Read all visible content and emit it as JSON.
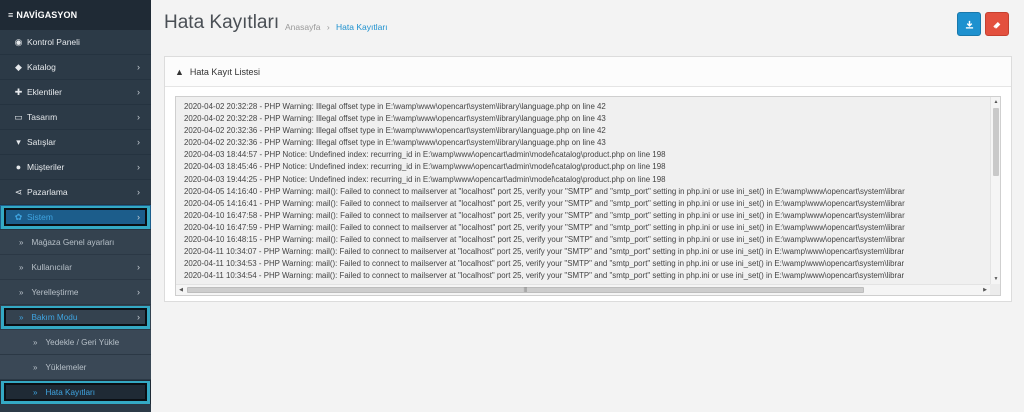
{
  "sidebar": {
    "heading": "NAVİGASYON",
    "items": [
      {
        "label": "Kontrol Paneli",
        "icon": "dashboard-icon",
        "glyph": "◉",
        "has_children": false
      },
      {
        "label": "Katalog",
        "icon": "tag-icon",
        "glyph": "◆",
        "has_children": true
      },
      {
        "label": "Eklentiler",
        "icon": "puzzle-icon",
        "glyph": "✚",
        "has_children": true
      },
      {
        "label": "Tasarım",
        "icon": "monitor-icon",
        "glyph": "▭",
        "has_children": true
      },
      {
        "label": "Satışlar",
        "icon": "cart-icon",
        "glyph": "▾",
        "has_children": true
      },
      {
        "label": "Müşteriler",
        "icon": "user-icon",
        "glyph": "●",
        "has_children": true
      },
      {
        "label": "Pazarlama",
        "icon": "share-icon",
        "glyph": "⋖",
        "has_children": true
      },
      {
        "label": "Sistem",
        "icon": "gear-icon",
        "glyph": "✿",
        "has_children": true
      }
    ],
    "system_children": [
      {
        "label": "Mağaza Genel ayarları"
      },
      {
        "label": "Kullanıcılar"
      },
      {
        "label": "Yerelleştirme"
      },
      {
        "label": "Bakım Modu"
      }
    ],
    "maintenance_children": [
      {
        "label": "Yedekle / Geri Yükle"
      },
      {
        "label": "Yüklemeler"
      },
      {
        "label": "Hata Kayıtları"
      }
    ]
  },
  "header": {
    "title": "Hata Kayıtları",
    "breadcrumb": [
      "Anasayfa",
      "Hata Kayıtları"
    ],
    "download_icon": "download-icon",
    "clear_icon": "eraser-icon"
  },
  "panel": {
    "title": "Hata Kayıt Listesi",
    "log_lines": [
      "2020-04-02 20:32:28 - PHP Warning:  Illegal offset type in E:\\wamp\\www\\opencart\\system\\library\\language.php on line 42",
      "2020-04-02 20:32:28 - PHP Warning:  Illegal offset type in E:\\wamp\\www\\opencart\\system\\library\\language.php on line 43",
      "2020-04-02 20:32:36 - PHP Warning:  Illegal offset type in E:\\wamp\\www\\opencart\\system\\library\\language.php on line 42",
      "2020-04-02 20:32:36 - PHP Warning:  Illegal offset type in E:\\wamp\\www\\opencart\\system\\library\\language.php on line 43",
      "2020-04-03 18:44:57 - PHP Notice:  Undefined index: recurring_id in E:\\wamp\\www\\opencart\\admin\\model\\catalog\\product.php on line 198",
      "2020-04-03 18:45:46 - PHP Notice:  Undefined index: recurring_id in E:\\wamp\\www\\opencart\\admin\\model\\catalog\\product.php on line 198",
      "2020-04-03 19:44:25 - PHP Notice:  Undefined index: recurring_id in E:\\wamp\\www\\opencart\\admin\\model\\catalog\\product.php on line 198",
      "2020-04-05 14:16:40 - PHP Warning:  mail(): Failed to connect to mailserver at \"localhost\" port 25, verify your \"SMTP\" and \"smtp_port\" setting in php.ini or use ini_set() in E:\\wamp\\www\\opencart\\system\\librar",
      "2020-04-05 14:16:41 - PHP Warning:  mail(): Failed to connect to mailserver at \"localhost\" port 25, verify your \"SMTP\" and \"smtp_port\" setting in php.ini or use ini_set() in E:\\wamp\\www\\opencart\\system\\librar",
      "2020-04-10 16:47:58 - PHP Warning:  mail(): Failed to connect to mailserver at \"localhost\" port 25, verify your \"SMTP\" and \"smtp_port\" setting in php.ini or use ini_set() in E:\\wamp\\www\\opencart\\system\\librar",
      "2020-04-10 16:47:59 - PHP Warning:  mail(): Failed to connect to mailserver at \"localhost\" port 25, verify your \"SMTP\" and \"smtp_port\" setting in php.ini or use ini_set() in E:\\wamp\\www\\opencart\\system\\librar",
      "2020-04-10 16:48:15 - PHP Warning:  mail(): Failed to connect to mailserver at \"localhost\" port 25, verify your \"SMTP\" and \"smtp_port\" setting in php.ini or use ini_set() in E:\\wamp\\www\\opencart\\system\\librar",
      "2020-04-11 10:34:07 - PHP Warning:  mail(): Failed to connect to mailserver at \"localhost\" port 25, verify your \"SMTP\" and \"smtp_port\" setting in php.ini or use ini_set() in E:\\wamp\\www\\opencart\\system\\librar",
      "2020-04-11 10:34:53 - PHP Warning:  mail(): Failed to connect to mailserver at \"localhost\" port 25, verify your \"SMTP\" and \"smtp_port\" setting in php.ini or use ini_set() in E:\\wamp\\www\\opencart\\system\\librar",
      "2020-04-11 10:34:54 - PHP Warning:  mail(): Failed to connect to mailserver at \"localhost\" port 25, verify your \"SMTP\" and \"smtp_port\" setting in php.ini or use ini_set() in E:\\wamp\\www\\opencart\\system\\librar"
    ]
  },
  "colors": {
    "sidebar_bg": "#2c3a47",
    "active_blue": "#1e91cf",
    "danger_red": "#e3503e",
    "highlight_teal": "#34a9c4"
  }
}
